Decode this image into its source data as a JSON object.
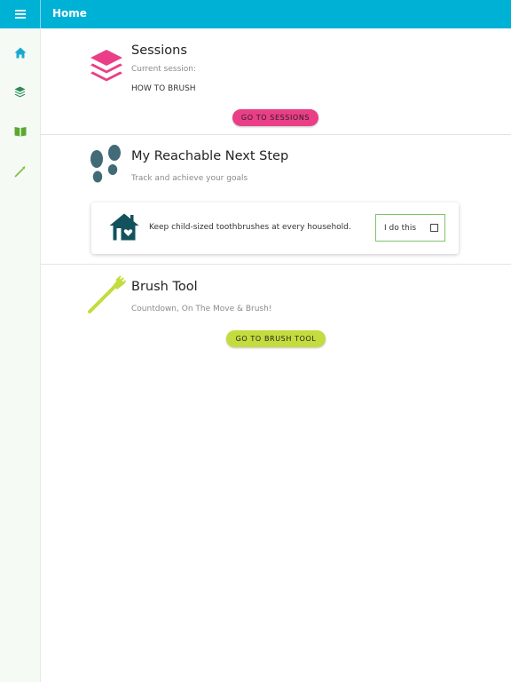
{
  "app": {
    "title": "Home",
    "accent_color": "#00b1d6",
    "menu_icon": "hamburger-menu-icon"
  },
  "sidebar": {
    "items": [
      {
        "name": "home",
        "icon": "home-icon",
        "color": "#1aa9cf"
      },
      {
        "name": "sessions",
        "icon": "layers-icon",
        "color": "#2e8b57"
      },
      {
        "name": "library",
        "icon": "book-icon",
        "color": "#5aa832"
      },
      {
        "name": "brush-tool",
        "icon": "toothbrush-icon",
        "color": "#7cbf3a"
      }
    ]
  },
  "sessions": {
    "icon": "layers-icon",
    "title": "Sessions",
    "current_label": "Current session:",
    "current_value": "HOW TO BRUSH",
    "button_label": "GO TO SESSIONS",
    "color": "#ea3e87"
  },
  "next_step": {
    "icon": "footsteps-icon",
    "title": "My Reachable Next Step",
    "subtitle": "Track and achieve your goals",
    "icon_color": "#426a77",
    "card": {
      "icon": "house-heart-icon",
      "text": "Keep child-sized toothbrushes at every household.",
      "checkbox_label": "I do this",
      "checked": false
    }
  },
  "brush_tool": {
    "icon": "toothbrush-icon",
    "title": "Brush Tool",
    "subtitle": "Countdown, On The Move & Brush!",
    "button_label": "GO TO BRUSH TOOL",
    "color": "#c4dc3e"
  }
}
